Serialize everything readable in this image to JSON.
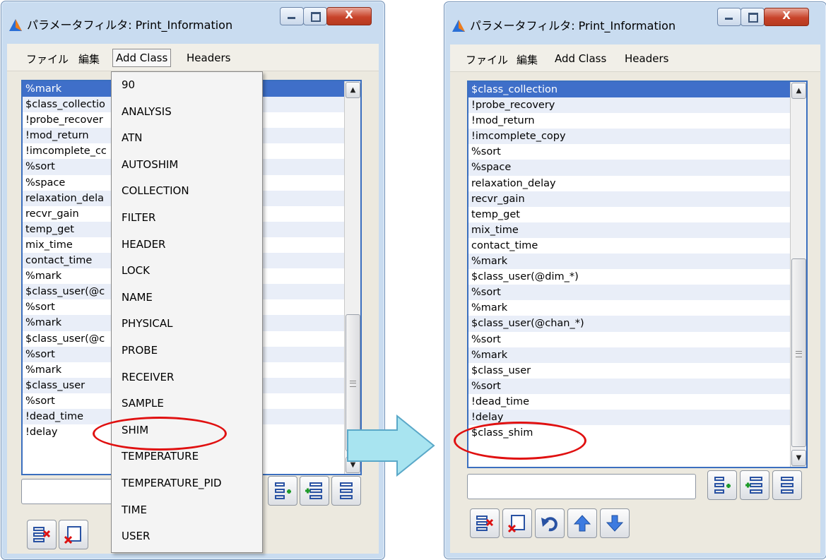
{
  "left_window": {
    "title": "パラメータフィルタ: Print_Information",
    "menu": [
      "ファイル",
      "編集",
      "Add Class",
      "Headers"
    ],
    "list": [
      "%mark",
      "$class_collectio",
      "!probe_recover",
      "!mod_return",
      "!imcomplete_cc",
      "%sort",
      "%space",
      "relaxation_dela",
      "recvr_gain",
      "temp_get",
      "mix_time",
      "contact_time",
      "%mark",
      "$class_user(@c",
      "%sort",
      "%mark",
      "$class_user(@c",
      "%sort",
      "%mark",
      "$class_user",
      "%sort",
      "!dead_time",
      "!delay"
    ],
    "selected_index": 0
  },
  "dropdown": {
    "items": [
      "90",
      "ANALYSIS",
      "ATN",
      "AUTOSHIM",
      "COLLECTION",
      "FILTER",
      "HEADER",
      "LOCK",
      "NAME",
      "PHYSICAL",
      "PROBE",
      "RECEIVER",
      "SAMPLE",
      "SHIM",
      "TEMPERATURE",
      "TEMPERATURE_PID",
      "TIME",
      "USER"
    ],
    "highlighted": "SHIM"
  },
  "right_window": {
    "title": "パラメータフィルタ: Print_Information",
    "menu": [
      "ファイル",
      "編集",
      "Add Class",
      "Headers"
    ],
    "list": [
      "$class_collection",
      "!probe_recovery",
      "!mod_return",
      "!imcomplete_copy",
      "%sort",
      "%space",
      "relaxation_delay",
      "recvr_gain",
      "temp_get",
      "mix_time",
      "contact_time",
      "%mark",
      "$class_user(@dim_*)",
      "%sort",
      "%mark",
      "$class_user(@chan_*)",
      "%sort",
      "%mark",
      "$class_user",
      "%sort",
      "!dead_time",
      "!delay",
      "$class_shim"
    ],
    "selected_index": 0,
    "highlighted": "$class_shim"
  },
  "icons": [
    "app-icon",
    "minimize-icon",
    "maximize-icon",
    "close-icon",
    "scroll-up-arrow-icon",
    "scroll-down-arrow-icon",
    "add-class-icon",
    "insert-icon",
    "list-icon",
    "delete-icon",
    "clear-icon",
    "undo-icon",
    "move-up-icon",
    "move-down-icon",
    "transition-arrow-icon"
  ],
  "colors": {
    "selection": "#3f6fc9",
    "annotation": "#e01010",
    "arrow": "#a8e4f0"
  }
}
